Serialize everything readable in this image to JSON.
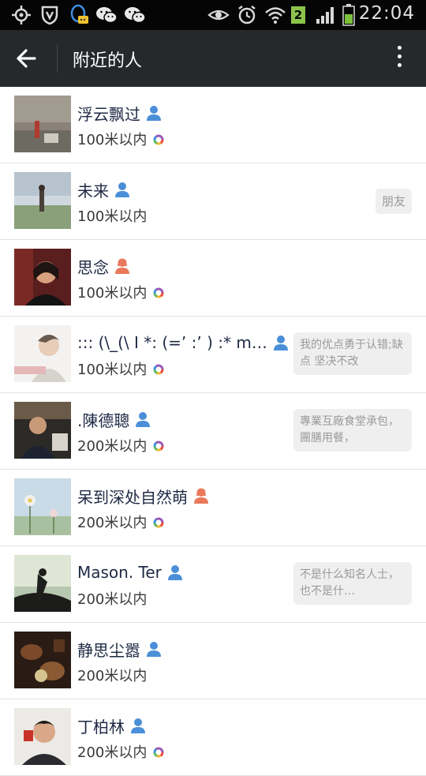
{
  "status_bar": {
    "time": "22:04",
    "sim_badge": "2",
    "icons": [
      "gps-icon",
      "vpn-shield-icon",
      "qq-icon",
      "wechat-icon",
      "wechat-icon",
      "eye-icon",
      "alarm-icon",
      "wifi-icon",
      "signal-icon",
      "battery-icon"
    ]
  },
  "header": {
    "title": "附近的人"
  },
  "people": [
    {
      "name": "浮云飘过",
      "gender": "male",
      "distance": "100米以内",
      "moments": true,
      "signature": "",
      "tag": ""
    },
    {
      "name": "未来",
      "gender": "male",
      "distance": "100米以内",
      "moments": false,
      "signature": "",
      "tag": "朋友"
    },
    {
      "name": "思念",
      "gender": "female",
      "distance": "100米以内",
      "moments": true,
      "signature": "",
      "tag": ""
    },
    {
      "name": "::: (\\_(\\ I *: (=’ :’ ) :* m…",
      "gender": "male",
      "distance": "100米以内",
      "moments": true,
      "signature": "我的优点勇于认错;缺点 坚决不改",
      "tag": ""
    },
    {
      "name": ".陳德聰",
      "gender": "male",
      "distance": "200米以内",
      "moments": true,
      "signature": "專業互廠食堂承包，團膳用餐，",
      "tag": ""
    },
    {
      "name": "呆到深处自然萌",
      "gender": "female",
      "distance": "200米以内",
      "moments": true,
      "signature": "",
      "tag": ""
    },
    {
      "name": "Mason. Ter",
      "gender": "male",
      "distance": "200米以内",
      "moments": false,
      "signature": "不是什么知名人士，也不是什…",
      "tag": ""
    },
    {
      "name": "静思尘嚣",
      "gender": "male",
      "distance": "200米以内",
      "moments": false,
      "signature": "",
      "tag": ""
    },
    {
      "name": "丁柏林",
      "gender": "male",
      "distance": "200米以内",
      "moments": true,
      "signature": "",
      "tag": ""
    }
  ],
  "colors": {
    "action_bar": "#25292b",
    "status_bar": "#050505",
    "male": "#4a8fd8",
    "female": "#e8795a",
    "name_text": "#1e2a44"
  }
}
